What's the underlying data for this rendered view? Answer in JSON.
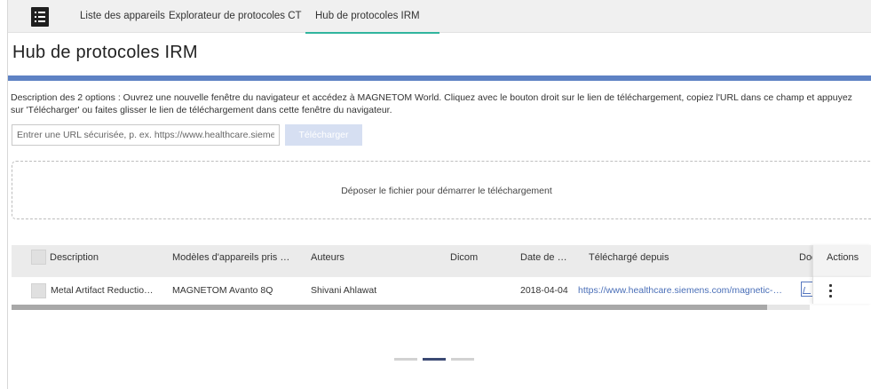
{
  "nav": {
    "tabs": [
      {
        "label": "Liste des appareils"
      },
      {
        "label": "Explorateur de protocoles CT"
      },
      {
        "label": "Hub de protocoles IRM"
      }
    ]
  },
  "page": {
    "title": "Hub de protocoles IRM",
    "accent_color": "#5e82c4",
    "description": "Description des 2 options : Ouvrez une nouvelle fenêtre du navigateur et accédez à MAGNETOM World. Cliquez avec le bouton droit sur le lien de téléchargement, copiez l'URL dans ce champ et appuyez sur 'Télécharger' ou faites glisser le lien de téléchargement dans cette fenêtre du navigateur."
  },
  "upload": {
    "url_placeholder": "Entrer une URL sécurisée, p. ex. https://www.healthcare.siemens.com",
    "url_value": "",
    "button_label": "Télécharger",
    "dropzone_text": "Déposer le fichier pour démarrer le téléchargement"
  },
  "table": {
    "headers": {
      "description": "Description",
      "models": "Modèles d'appareils pris en charge",
      "authors": "Auteurs",
      "dicom": "Dicom",
      "date": "Date de téléchargement",
      "source": "Téléchargé depuis",
      "doc": "Documents",
      "actions": "Actions"
    },
    "rows": [
      {
        "description": "Metal Artifact Reduction Protocols",
        "models": "MAGNETOM Avanto 8Q",
        "authors": "Shivani Ahlawat",
        "dicom": "",
        "date": "2018-04-04",
        "source": "https://www.healthcare.siemens.com/magnetic-resonance-imaging",
        "doc_icon": "pdf-icon",
        "action_icon": "kebab-menu-icon"
      }
    ]
  },
  "pagination": {
    "pages": 3,
    "active_index": 1
  }
}
